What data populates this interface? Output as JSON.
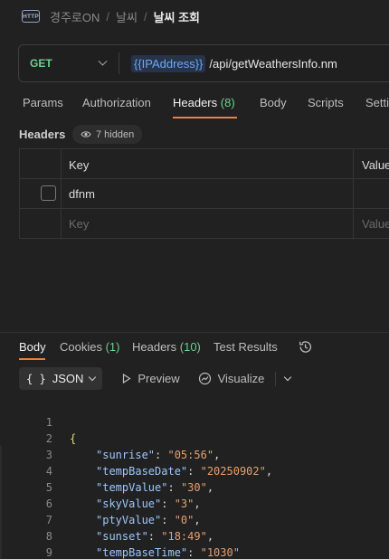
{
  "breadcrumb": {
    "icon": "http-icon",
    "icon_text": "HTTP",
    "items": [
      "경주로ON",
      "날씨"
    ],
    "current": "날씨 조회",
    "separator": "/"
  },
  "request": {
    "method": "GET",
    "url_variable": "{{IPAddress}}",
    "url_path": "/api/getWeathersInfo.nm"
  },
  "request_tabs": {
    "params": "Params",
    "authorization": "Authorization",
    "headers": "Headers",
    "headers_count": "(8)",
    "body": "Body",
    "scripts": "Scripts",
    "settings": "Setti"
  },
  "headers_section": {
    "label": "Headers",
    "hidden_label": "7 hidden",
    "col_key": "Key",
    "col_value": "Value",
    "rows": [
      {
        "key": "dfnm",
        "value": ""
      }
    ],
    "key_placeholder": "Key",
    "value_placeholder": "Value"
  },
  "response_tabs": {
    "body": "Body",
    "cookies": "Cookies",
    "cookies_count": "(1)",
    "headers": "Headers",
    "headers_count": "(10)",
    "test_results": "Test Results"
  },
  "response_toolbar": {
    "format_icon": "{ }",
    "format": "JSON",
    "preview": "Preview",
    "visualize": "Visualize"
  },
  "response_body": {
    "line_numbers": [
      "1",
      "2",
      "3",
      "4",
      "5",
      "6",
      "7",
      "8",
      "9"
    ],
    "open_brace": "{",
    "close_brace": "}",
    "fields": [
      {
        "key": "\"sunrise\"",
        "value": "\"05:56\""
      },
      {
        "key": "\"tempBaseDate\"",
        "value": "\"20250902\""
      },
      {
        "key": "\"tempValue\"",
        "value": "\"30\""
      },
      {
        "key": "\"skyValue\"",
        "value": "\"3\""
      },
      {
        "key": "\"ptyValue\"",
        "value": "\"0\""
      },
      {
        "key": "\"sunset\"",
        "value": "\"18:49\""
      },
      {
        "key": "\"tempBaseTime\"",
        "value": "\"1030\""
      }
    ]
  },
  "colors": {
    "accent": "#f07e3f",
    "method_get": "#6dd18c",
    "count_green": "#6dd18c",
    "json_key": "#9cc7ff",
    "json_string": "#e6a06f",
    "json_brace": "#e8d680"
  }
}
